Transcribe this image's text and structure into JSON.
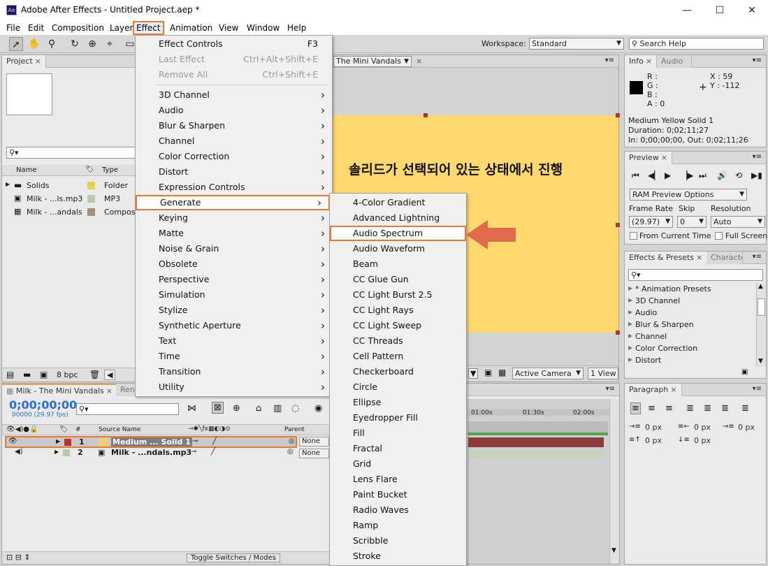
{
  "window": {
    "title": "Adobe After Effects - Untitled Project.aep *",
    "app_icon": "Ae",
    "minimize": "—",
    "maximize": "☐",
    "close": "✕"
  },
  "menubar": [
    "File",
    "Edit",
    "Composition",
    "Layer",
    "Effect",
    "Animation",
    "View",
    "Window",
    "Help"
  ],
  "toolbar": {
    "workspace_label": "Workspace:",
    "workspace_value": "Standard",
    "search_help": "Search Help"
  },
  "project": {
    "tab": "Project",
    "columns": {
      "name": "Name",
      "type": "Type"
    },
    "items": [
      {
        "name": "Solids",
        "color": "#e2d24a",
        "type": "Folder"
      },
      {
        "name": "Milk - ...ls.mp3",
        "color": "#b9cab0",
        "type": "MP3"
      },
      {
        "name": "Milk - ...andals",
        "color": "#a89074",
        "type": "Compos"
      }
    ],
    "bpc": "8 bpc"
  },
  "comp_viewer": {
    "tab": "The Mini Vandals",
    "annotation": "솔리드가 선택되어 있는 상태에서 진행",
    "solid_color": "#ffd96e",
    "active_camera": "Active Camera",
    "view_count": "1 View"
  },
  "effect_menu": {
    "items": [
      {
        "label": "Effect Controls",
        "shortcut": "F3",
        "enabled": true,
        "submenu": false
      },
      {
        "label": "Last Effect",
        "shortcut": "Ctrl+Alt+Shift+E",
        "enabled": false,
        "submenu": false
      },
      {
        "label": "Remove All",
        "shortcut": "Ctrl+Shift+E",
        "enabled": false,
        "submenu": false
      },
      {
        "label": "3D Channel",
        "submenu": true
      },
      {
        "label": "Audio",
        "submenu": true
      },
      {
        "label": "Blur & Sharpen",
        "submenu": true
      },
      {
        "label": "Channel",
        "submenu": true
      },
      {
        "label": "Color Correction",
        "submenu": true
      },
      {
        "label": "Distort",
        "submenu": true
      },
      {
        "label": "Expression Controls",
        "submenu": true
      },
      {
        "label": "Generate",
        "submenu": true,
        "highlighted": true
      },
      {
        "label": "Keying",
        "submenu": true
      },
      {
        "label": "Matte",
        "submenu": true
      },
      {
        "label": "Noise & Grain",
        "submenu": true
      },
      {
        "label": "Obsolete",
        "submenu": true
      },
      {
        "label": "Perspective",
        "submenu": true
      },
      {
        "label": "Simulation",
        "submenu": true
      },
      {
        "label": "Stylize",
        "submenu": true
      },
      {
        "label": "Synthetic Aperture",
        "submenu": true
      },
      {
        "label": "Text",
        "submenu": true
      },
      {
        "label": "Time",
        "submenu": true
      },
      {
        "label": "Transition",
        "submenu": true
      },
      {
        "label": "Utility",
        "submenu": true
      }
    ]
  },
  "generate_submenu": {
    "items": [
      {
        "label": "4-Color Gradient"
      },
      {
        "label": "Advanced Lightning"
      },
      {
        "label": "Audio Spectrum",
        "highlighted": true
      },
      {
        "label": "Audio Waveform"
      },
      {
        "label": "Beam"
      },
      {
        "label": "CC Glue Gun"
      },
      {
        "label": "CC Light Burst 2.5"
      },
      {
        "label": "CC Light Rays"
      },
      {
        "label": "CC Light Sweep"
      },
      {
        "label": "CC Threads"
      },
      {
        "label": "Cell Pattern"
      },
      {
        "label": "Checkerboard"
      },
      {
        "label": "Circle"
      },
      {
        "label": "Ellipse"
      },
      {
        "label": "Eyedropper Fill"
      },
      {
        "label": "Fill"
      },
      {
        "label": "Fractal"
      },
      {
        "label": "Grid"
      },
      {
        "label": "Lens Flare"
      },
      {
        "label": "Paint Bucket"
      },
      {
        "label": "Radio Waves"
      },
      {
        "label": "Ramp"
      },
      {
        "label": "Scribble"
      },
      {
        "label": "Stroke"
      }
    ],
    "pointer_arrow_color": "#e06a4a"
  },
  "info": {
    "tab": "Info",
    "tab2": "Audio",
    "r": "R :",
    "g": "G :",
    "b": "B :",
    "a": "A : 0",
    "x": "X : 59",
    "y": "Y : -112",
    "layer_name": "Medium Yellow Solid 1",
    "duration": "Duration: 0;02;11;27",
    "in_out": "In: 0;00;00;00, Out: 0;02;11;26"
  },
  "preview": {
    "tab": "Preview",
    "ram_preview": "RAM Preview Options",
    "frame_rate_label": "Frame Rate",
    "skip_label": "Skip",
    "resolution_label": "Resolution",
    "frame_rate": "(29.97)",
    "skip": "0",
    "resolution": "Auto",
    "from_current": "From Current Time",
    "full_screen": "Full Screen"
  },
  "effects_presets": {
    "tab": "Effects & Presets",
    "tab2": "Characte",
    "items": [
      "* Animation Presets",
      "3D Channel",
      "Audio",
      "Blur & Sharpen",
      "Channel",
      "Color Correction",
      "Distort"
    ]
  },
  "timeline": {
    "tab": "Milk - The Mini Vandals",
    "tab2": "Ren",
    "timecode": "0;00;00;00",
    "fps": "00000 (29.97 fps)",
    "columns": {
      "num": "#",
      "source": "Source Name",
      "parent": "Parent"
    },
    "ruler": [
      "01:00s",
      "01:30s",
      "02:00s"
    ],
    "layers": [
      {
        "num": "1",
        "name": "Medium ... Solid 1",
        "label_color": "#c0302a",
        "icon_color": "#f5cf68",
        "parent": "None",
        "selected": true
      },
      {
        "num": "2",
        "name": "Milk - ...ndals.mp3",
        "label_color": "#b9cab0",
        "parent": "None",
        "selected": false
      }
    ],
    "toggle": "Toggle Switches / Modes"
  },
  "paragraph": {
    "tab": "Paragraph",
    "values": [
      "0 px",
      "0 px",
      "0 px",
      "0 px",
      "0 px"
    ]
  }
}
